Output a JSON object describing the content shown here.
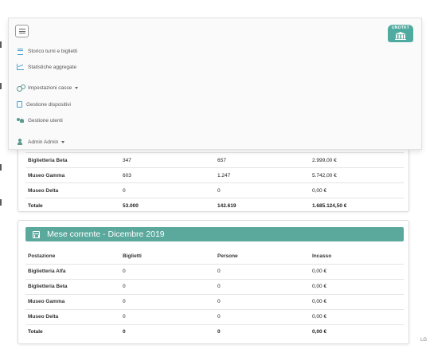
{
  "brand": {
    "logo_text": "UNOTKT",
    "accent_color": "#5ba89d"
  },
  "nav": {
    "items": [
      {
        "label": "Storico turni e biglietti",
        "icon": "list-icon"
      },
      {
        "label": "Statistiche aggregate",
        "icon": "chart-icon"
      },
      {
        "label": "Impostazioni casse",
        "icon": "cogs-icon",
        "dropdown": true
      },
      {
        "label": "Gestione dispositivi",
        "icon": "tablet-icon"
      },
      {
        "label": "Gestione utenti",
        "icon": "users-icon"
      },
      {
        "label": "Admin Admin",
        "icon": "user-icon",
        "dropdown": true
      }
    ]
  },
  "card1": {
    "rows": [
      {
        "postazione": "Biglietteria Beta",
        "biglietti": "347",
        "persone": "657",
        "incasso": "2.999,00 €"
      },
      {
        "postazione": "Museo Gamma",
        "biglietti": "603",
        "persone": "1.247",
        "incasso": "5.742,00 €"
      },
      {
        "postazione": "Museo Delta",
        "biglietti": "0",
        "persone": "0",
        "incasso": "0,00 €"
      }
    ],
    "total": {
      "label": "Totale",
      "biglietti": "53.000",
      "persone": "142.619",
      "incasso": "1.685.124,50 €"
    }
  },
  "card2": {
    "title": "Mese corrente - Dicembre 2019",
    "headers": {
      "postazione": "Postazione",
      "biglietti": "Biglietti",
      "persone": "Persone",
      "incasso": "Incasso"
    },
    "rows": [
      {
        "postazione": "Biglietteria Alfa",
        "biglietti": "0",
        "persone": "0",
        "incasso": "0,00 €"
      },
      {
        "postazione": "Biglietteria Beta",
        "biglietti": "0",
        "persone": "0",
        "incasso": "0,00 €"
      },
      {
        "postazione": "Museo Gamma",
        "biglietti": "0",
        "persone": "0",
        "incasso": "0,00 €"
      },
      {
        "postazione": "Museo Delta",
        "biglietti": "0",
        "persone": "0",
        "incasso": "0,00 €"
      }
    ],
    "total": {
      "label": "Totale",
      "biglietti": "0",
      "persone": "0",
      "incasso": "0,00 €"
    }
  },
  "footer": {
    "corner_text": "LG"
  }
}
